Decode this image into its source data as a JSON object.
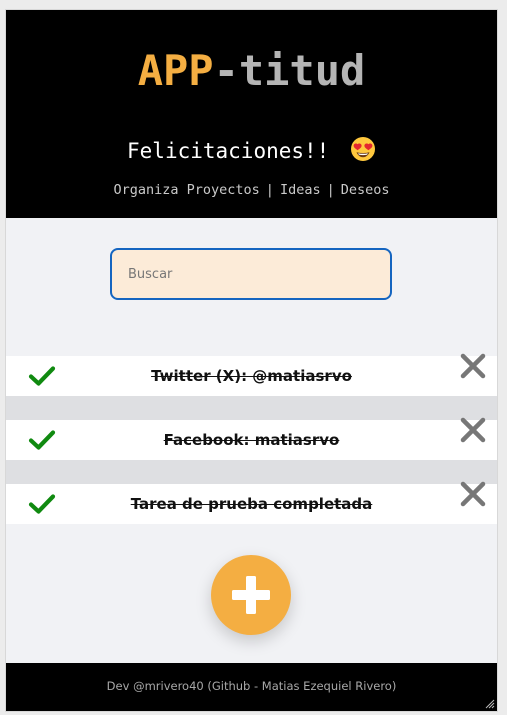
{
  "header": {
    "title_part1": "APP",
    "title_part2": "-titud",
    "congrats": "Felicitaciones!!",
    "emoji_icon": "heart-eyes-emoji",
    "nav": [
      {
        "label": "Organiza Proyectos"
      },
      {
        "label": "Ideas"
      },
      {
        "label": "Deseos"
      }
    ],
    "nav_separator": "|"
  },
  "search": {
    "placeholder": "Buscar",
    "value": ""
  },
  "tasks": [
    {
      "text": "Twitter (X): @matiasrvo",
      "completed": true
    },
    {
      "text": "Facebook: matiasrvo",
      "completed": true
    },
    {
      "text": "Tarea de prueba completada",
      "completed": true
    }
  ],
  "footer": {
    "text": "Dev @mrivero40 (Github - Matias Ezequiel Rivero)"
  },
  "colors": {
    "accent": "#f4ae42",
    "title_secondary": "#b5b5b5",
    "check": "#108a10",
    "delete": "#777777",
    "search_border": "#1565c0",
    "search_bg": "#fcebd8"
  }
}
